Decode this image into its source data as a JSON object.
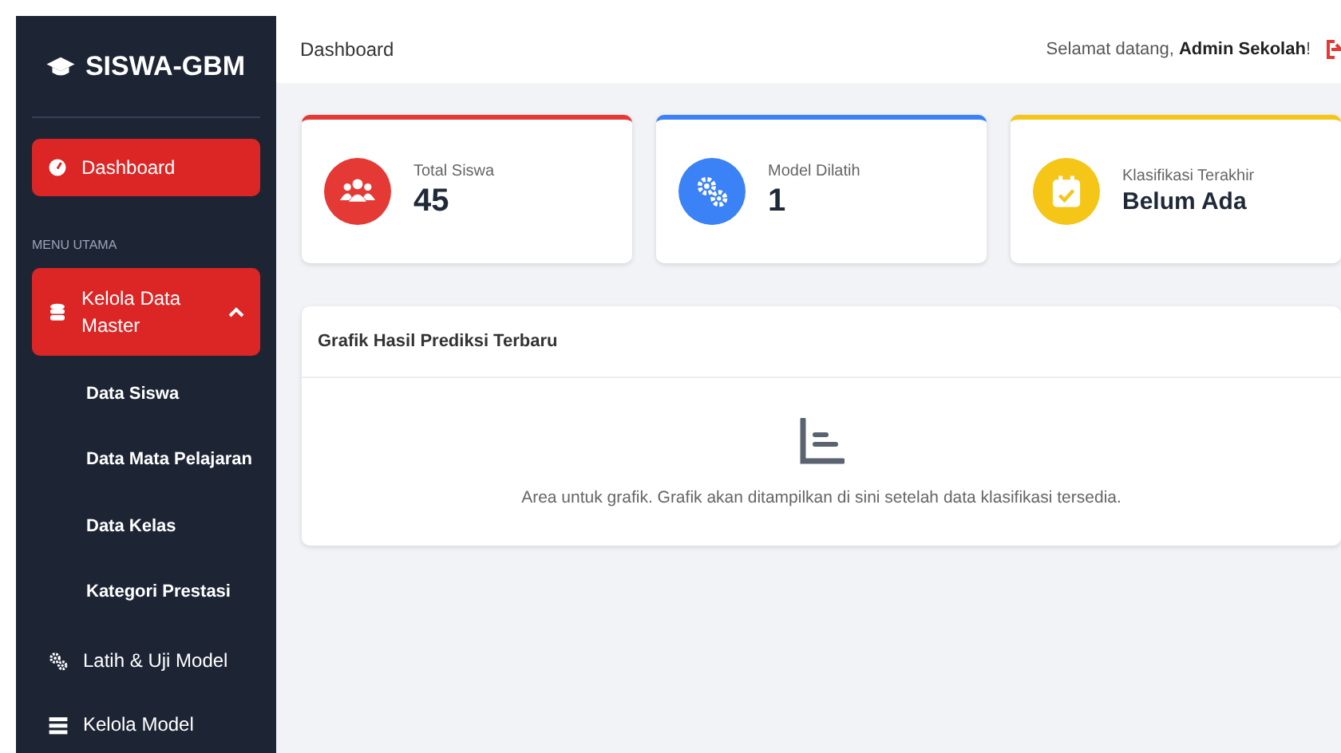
{
  "sidebar": {
    "brand": "SISWA-GBM",
    "items": [
      {
        "kind": "link",
        "label": "Dashboard",
        "selected": true
      },
      {
        "kind": "section",
        "label": "MENU UTAMA"
      },
      {
        "kind": "group",
        "label": "Kelola Data Master",
        "selected": true,
        "expanded": true,
        "children": [
          {
            "label": "Data Siswa",
            "selected": false
          },
          {
            "label": "Data Mata Pelajaran",
            "selected": false
          },
          {
            "label": "Data Kelas",
            "selected": false
          },
          {
            "label": "Kategori Prestasi",
            "selected": false
          }
        ]
      },
      {
        "kind": "link",
        "label": "Latih & Uji Model",
        "selected": false
      },
      {
        "kind": "link",
        "label": "Kelola Model",
        "selected": false
      }
    ]
  },
  "header": {
    "title": "Dashboard",
    "greeting": "Selamat datang, **Admin Sekolah**!"
  },
  "stats": [
    {
      "label": "Total Siswa",
      "value": "45",
      "color": "#e53935"
    },
    {
      "label": "Model Dilatih",
      "value": "1",
      "color": "#3b82f6"
    },
    {
      "label": "Klasifikasi Terakhir",
      "value": "Belum Ada",
      "color": "#f5c518"
    }
  ],
  "chart_panel": {
    "title": "Grafik Hasil Prediksi Terbaru",
    "message": "Area untuk grafik. Grafik akan ditampilkan di sini setelah data klasifikasi tersedia."
  }
}
